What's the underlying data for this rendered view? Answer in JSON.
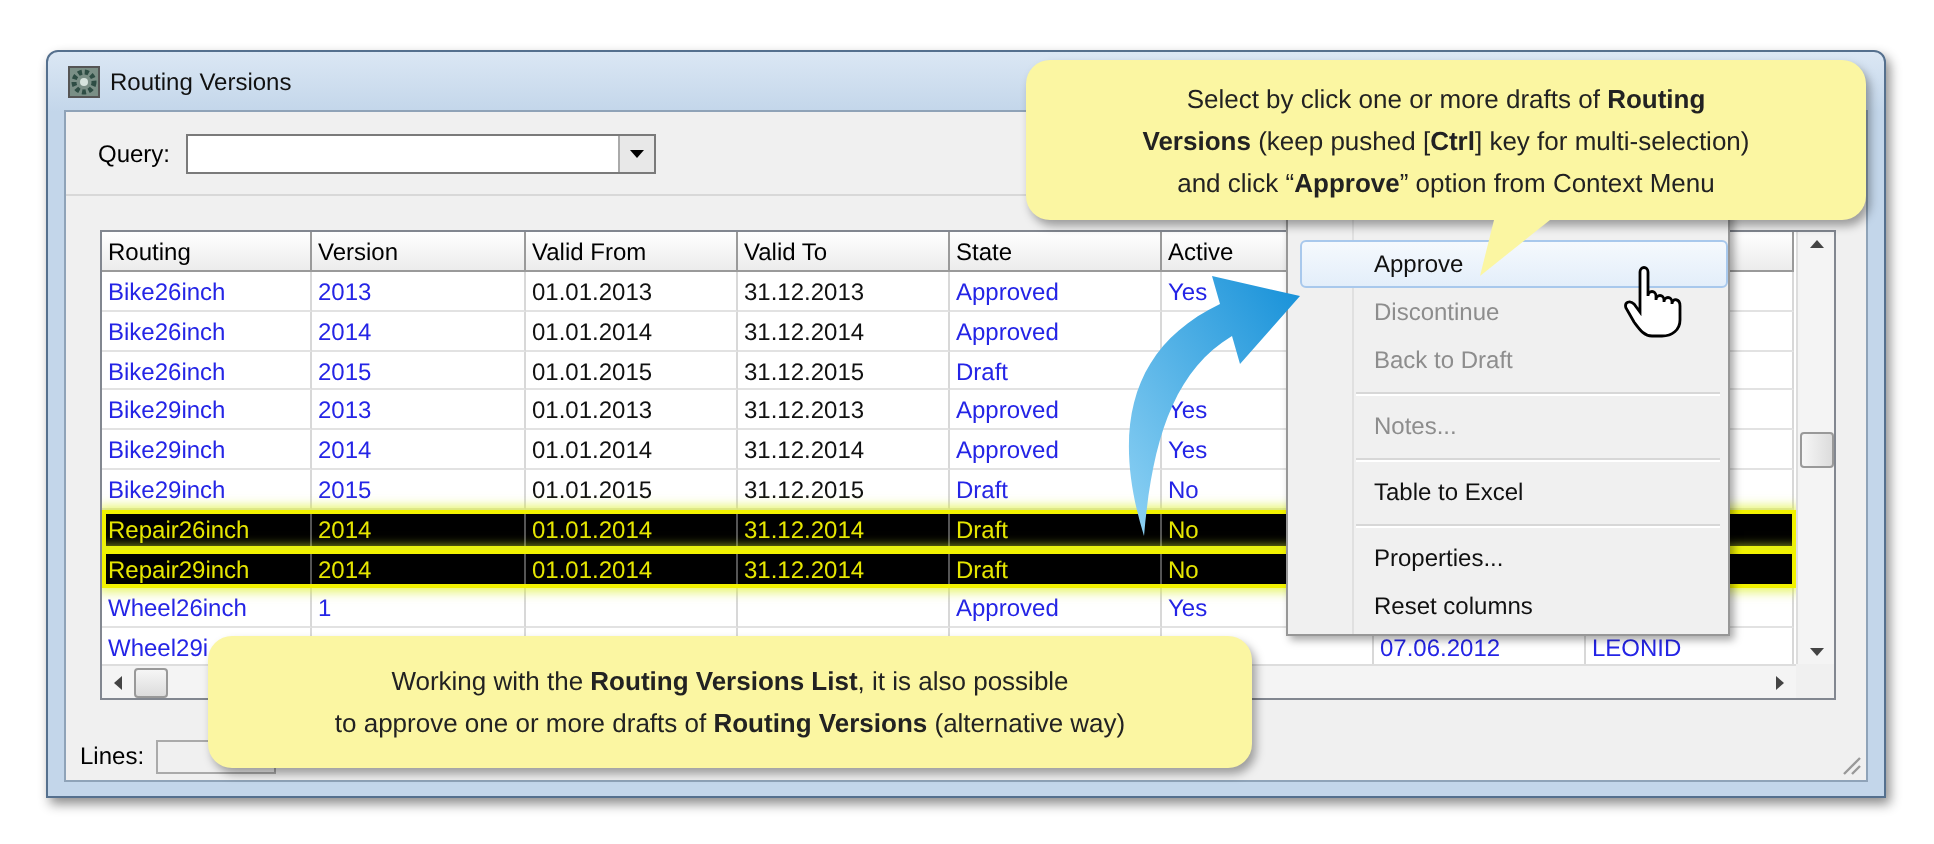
{
  "window": {
    "title": "Routing Versions"
  },
  "query": {
    "label": "Query:"
  },
  "table": {
    "columns": [
      "Routing",
      "Version",
      "Valid From",
      "Valid To",
      "State",
      "Active"
    ],
    "rows": [
      {
        "routing": "Bike26inch",
        "version": "2013",
        "valid_from": "01.01.2013",
        "valid_to": "31.12.2013",
        "state": "Approved",
        "active": "Yes",
        "selected": false
      },
      {
        "routing": "Bike26inch",
        "version": "2014",
        "valid_from": "01.01.2014",
        "valid_to": "31.12.2014",
        "state": "Approved",
        "selected": false
      },
      {
        "routing": "Bike26inch",
        "version": "2015",
        "valid_from": "01.01.2015",
        "valid_to": "31.12.2015",
        "state": "Draft",
        "selected": false
      },
      {
        "routing": "Bike29inch",
        "version": "2013",
        "valid_from": "01.01.2013",
        "valid_to": "31.12.2013",
        "state": "Approved",
        "active": "Yes",
        "selected": false
      },
      {
        "routing": "Bike29inch",
        "version": "2014",
        "valid_from": "01.01.2014",
        "valid_to": "31.12.2014",
        "state": "Approved",
        "active": "Yes",
        "selected": false
      },
      {
        "routing": "Bike29inch",
        "version": "2015",
        "valid_from": "01.01.2015",
        "valid_to": "31.12.2015",
        "state": "Draft",
        "active": "No",
        "selected": false
      },
      {
        "routing": "Repair26inch",
        "version": "2014",
        "valid_from": "01.01.2014",
        "valid_to": "31.12.2014",
        "state": "Draft",
        "active": "No",
        "selected": true
      },
      {
        "routing": "Repair29inch",
        "version": "2014",
        "valid_from": "01.01.2014",
        "valid_to": "31.12.2014",
        "state": "Draft",
        "active": "No",
        "selected": true
      },
      {
        "routing": "Wheel26inch",
        "version": "1",
        "state": "Approved",
        "active": "Yes",
        "selected": false
      },
      {
        "routing": "Wheel29i",
        "column_7": "07.06.2012",
        "column_8": "LEONID",
        "selected": false
      }
    ]
  },
  "context_menu": {
    "items": [
      {
        "kind": "item",
        "label": "Approve",
        "selected": true,
        "disabled": false
      },
      {
        "kind": "item",
        "label": "Discontinue",
        "selected": false,
        "disabled": true
      },
      {
        "kind": "item",
        "label": "Back to Draft",
        "selected": false,
        "disabled": true
      },
      {
        "kind": "separator"
      },
      {
        "kind": "item",
        "label": "Notes...",
        "selected": false,
        "disabled": true
      },
      {
        "kind": "separator"
      },
      {
        "kind": "item",
        "label": "Table to Excel",
        "selected": false,
        "disabled": false
      },
      {
        "kind": "separator"
      },
      {
        "kind": "item",
        "label": "Properties...",
        "selected": false,
        "disabled": false
      },
      {
        "kind": "item",
        "label": "Reset columns",
        "selected": false,
        "disabled": false
      }
    ]
  },
  "status_bar": {
    "lines_label": "Lines:"
  },
  "callouts": [
    {
      "kind": "top",
      "lines": [
        "Select by click one or more drafts of  **Routing**",
        "**Versions** (keep pushed [**Ctrl**] key for multi-selection)",
        "and click “**Approve**” option from Context Menu"
      ]
    },
    {
      "kind": "bottom",
      "lines": [
        "Working with the **Routing Versions List**, it is also possible",
        "to approve one or more drafts of **Routing Versions** (alternative way)"
      ]
    }
  ]
}
